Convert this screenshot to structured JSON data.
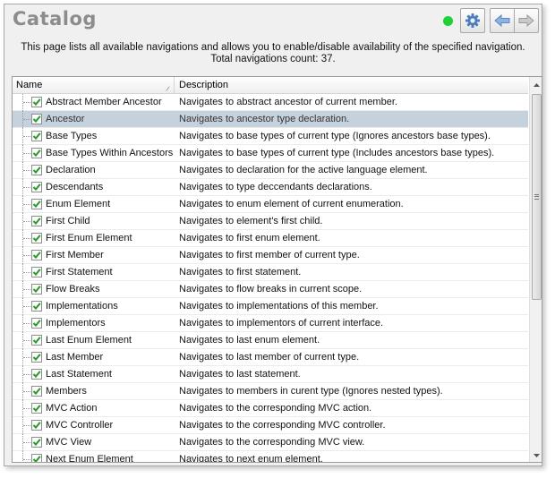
{
  "page": {
    "title": "Catalog",
    "description_line1": "This page lists all available navigations and allows you to enable/disable availability of the specified navigation.",
    "description_line2": "Total navigations count: 37."
  },
  "toolbar": {
    "status_color": "#1fd134",
    "settings_icon": "gear-icon",
    "back_icon": "arrow-left-icon",
    "forward_icon": "arrow-right-icon"
  },
  "grid": {
    "columns": [
      "Name",
      "Description"
    ],
    "selected_row_color": "#c6d1de",
    "rows": [
      {
        "name": "Abstract Member Ancestor",
        "description": "Navigates to abstract ancestor of current member.",
        "checked": true
      },
      {
        "name": "Ancestor",
        "description": "Navigates to ancestor type declaration.",
        "checked": true,
        "selected": true
      },
      {
        "name": "Base Types",
        "description": "Navigates to base types of current type (Ignores ancestors base types).",
        "checked": true
      },
      {
        "name": "Base Types Within Ancestors",
        "description": "Navigates to base types of current type (Includes ancestors base types).",
        "checked": true
      },
      {
        "name": "Declaration",
        "description": "Navigates to declaration for the active language element.",
        "checked": true
      },
      {
        "name": "Descendants",
        "description": "Navigates to type deccendants declarations.",
        "checked": true
      },
      {
        "name": "Enum Element",
        "description": "Navigates to enum element of current enumeration.",
        "checked": true
      },
      {
        "name": "First Child",
        "description": "Navigates to element's first child.",
        "checked": true
      },
      {
        "name": "First Enum Element",
        "description": "Navigates to first enum element.",
        "checked": true
      },
      {
        "name": "First Member",
        "description": "Navigates to first member of current type.",
        "checked": true
      },
      {
        "name": "First Statement",
        "description": "Navigates to first statement.",
        "checked": true
      },
      {
        "name": "Flow Breaks",
        "description": "Navigates to flow breaks in current scope.",
        "checked": true
      },
      {
        "name": "Implementations",
        "description": "Navigates to implementations of this member.",
        "checked": true
      },
      {
        "name": "Implementors",
        "description": "Navigates to implementors of current interface.",
        "checked": true
      },
      {
        "name": "Last Enum Element",
        "description": "Navigates to last enum element.",
        "checked": true
      },
      {
        "name": "Last Member",
        "description": "Navigates to last member of current type.",
        "checked": true
      },
      {
        "name": "Last Statement",
        "description": "Navigates to last statement.",
        "checked": true
      },
      {
        "name": "Members",
        "description": "Navigates to members in curent type (Ignores nested types).",
        "checked": true
      },
      {
        "name": "MVC Action",
        "description": "Navigates to the corresponding MVC action.",
        "checked": true
      },
      {
        "name": "MVC Controller",
        "description": "Navigates to the corresponding MVC controller.",
        "checked": true
      },
      {
        "name": "MVC View",
        "description": "Navigates to the corresponding MVC view.",
        "checked": true
      },
      {
        "name": "Next Enum Element",
        "description": "Navigates to next enum element.",
        "checked": true
      }
    ]
  }
}
